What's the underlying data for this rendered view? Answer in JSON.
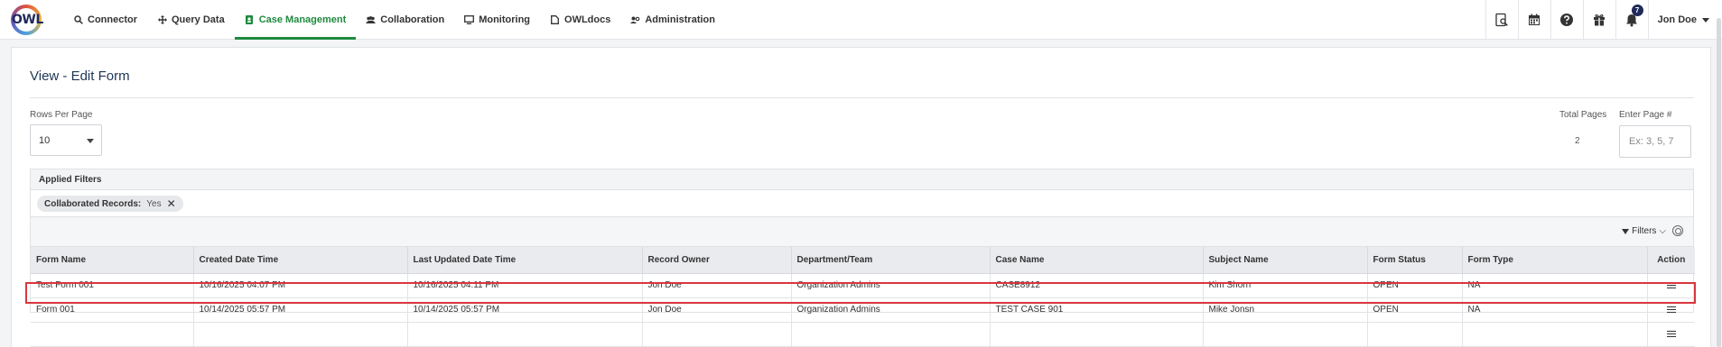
{
  "nav": {
    "items": [
      {
        "label": "Connector",
        "icon": "search-icon"
      },
      {
        "label": "Query Data",
        "icon": "move-icon"
      },
      {
        "label": "Case Management",
        "icon": "person-badge-icon",
        "active": true
      },
      {
        "label": "Collaboration",
        "icon": "people-icon"
      },
      {
        "label": "Monitoring",
        "icon": "monitor-icon"
      },
      {
        "label": "OWLdocs",
        "icon": "document-icon"
      },
      {
        "label": "Administration",
        "icon": "admin-icon"
      }
    ],
    "notification_count": "7",
    "user_name": "Jon Doe"
  },
  "page": {
    "title": "View - Edit Form",
    "rows_per_page_label": "Rows Per Page",
    "rows_per_page_value": "10",
    "total_pages_label": "Total Pages",
    "total_pages_value": "2",
    "enter_page_label": "Enter Page #",
    "enter_page_placeholder": "Ex: 3, 5, 7"
  },
  "filters": {
    "heading": "Applied Filters",
    "chip_label": "Collaborated Records:",
    "chip_value": "Yes",
    "filters_button": "Filters"
  },
  "table": {
    "columns": [
      "Form Name",
      "Created Date Time",
      "Last Updated Date Time",
      "Record Owner",
      "Department/Team",
      "Case Name",
      "Subject Name",
      "Form Status",
      "Form Type",
      "Action"
    ],
    "rows": [
      [
        "Test Form 001",
        "10/16/2025 04:07 PM",
        "10/16/2025 04:11 PM",
        "Jon Doe",
        "Organization Admins",
        "CASE8912",
        "Kim Shorn",
        "OPEN",
        "NA"
      ],
      [
        "Form 001",
        "10/14/2025 05:57 PM",
        "10/14/2025 05:57 PM",
        "Jon Doe",
        "Organization Admins",
        "TEST CASE 901",
        "Mike Jonsn",
        "OPEN",
        "NA"
      ],
      [
        "",
        "",
        "",
        "",
        "",
        "",
        "",
        "",
        ""
      ]
    ]
  },
  "colors": {
    "accent_green": "#1e8a3e",
    "highlight_red": "#d9363e",
    "title_navy": "#1f3554"
  }
}
